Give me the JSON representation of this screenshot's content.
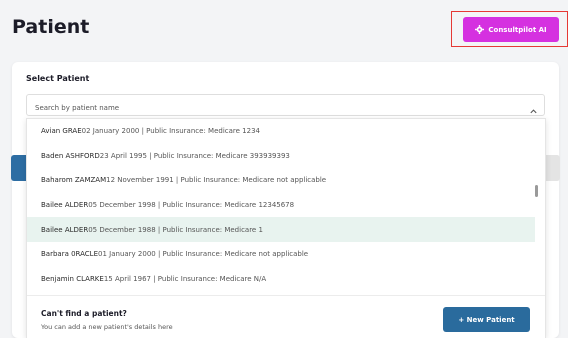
{
  "page": {
    "title": "Patient"
  },
  "consult_button": {
    "label": "Consultpilot AI",
    "icon": "gear-icon",
    "color": "#d531e0",
    "frame_color": "#e53935"
  },
  "select_patient": {
    "label": "Select Patient",
    "search": {
      "placeholder": "Search by patient name",
      "value": ""
    }
  },
  "patients": [
    {
      "name": "Avian GRAE",
      "details": "02 January 2000 | Public Insurance: Medicare 1234"
    },
    {
      "name": "Baden ASHFORD",
      "details": "23 April 1995 | Public Insurance: Medicare 393939393"
    },
    {
      "name": "Baharom ZAMZAM",
      "details": "12 November 1991 | Public Insurance: Medicare not applicable"
    },
    {
      "name": "Bailee ALDER",
      "details": "05 December 1998 | Public Insurance: Medicare 12345678"
    },
    {
      "name": "Bailee ALDER",
      "details": "05 December 1988 | Public Insurance: Medicare 1",
      "highlighted": true
    },
    {
      "name": "Barbara 0RACLE",
      "details": "01 January 2000 | Public Insurance: Medicare not applicable"
    },
    {
      "name": "Benjamin CLARKE",
      "details": "15 April 1967 | Public Insurance: Medicare N/A"
    }
  ],
  "footer": {
    "title": "Can't find a patient?",
    "subtitle": "You can add a new patient's details here",
    "new_button": {
      "label": "+ New Patient",
      "color": "#2a6b9d"
    }
  }
}
